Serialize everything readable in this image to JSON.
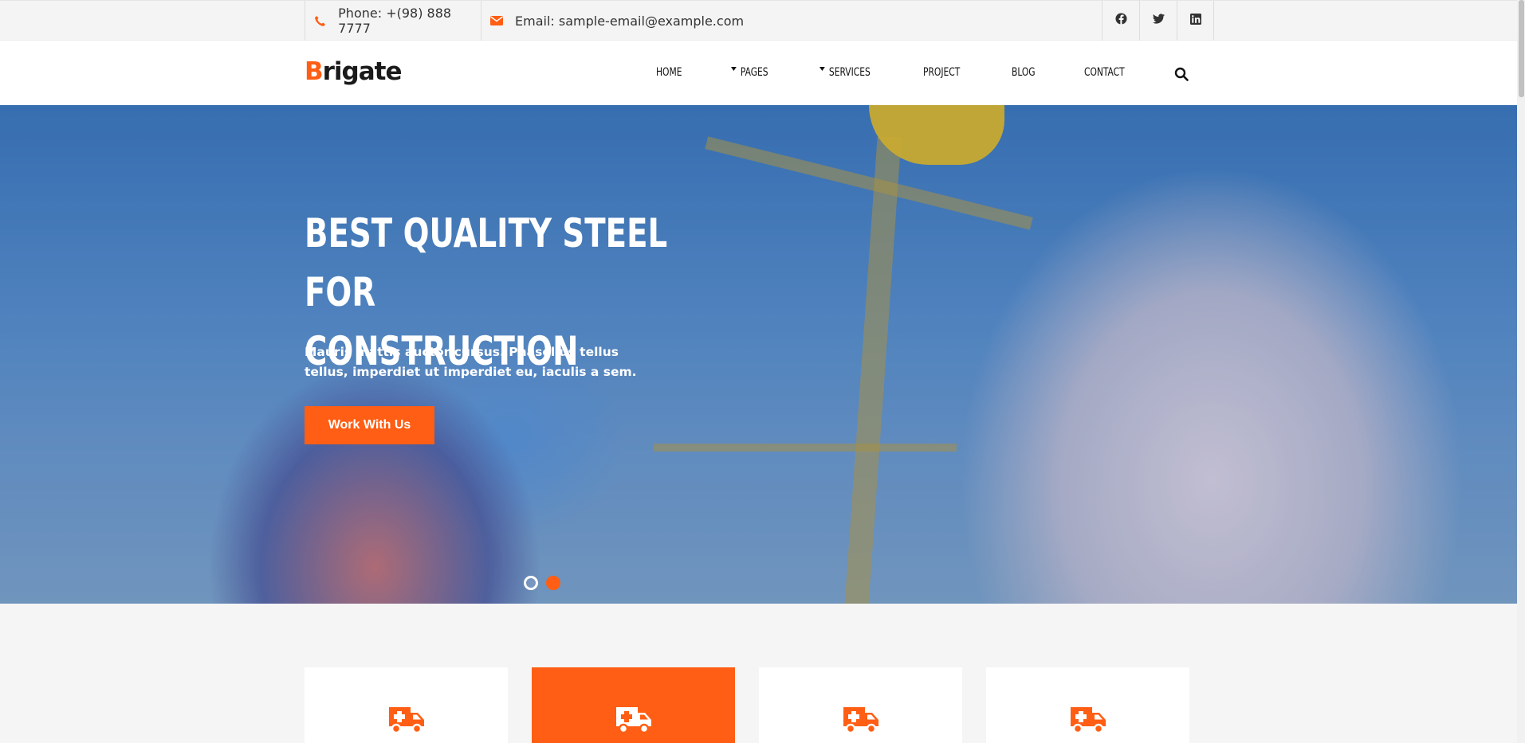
{
  "topbar": {
    "phone": "Phone: +(98) 888 7777",
    "email": "Email: sample-email@example.com",
    "social": [
      "facebook-icon",
      "twitter-icon",
      "linkedin-icon"
    ]
  },
  "header": {
    "logo_first": "B",
    "logo_rest": "rigate",
    "nav": [
      "HOME",
      "PAGES",
      "SERVICES",
      "PROJECT",
      "BLOG",
      "CONTACT"
    ]
  },
  "hero": {
    "title_line1": "BEST QUALITY STEEL FOR",
    "title_line2": "CONSTRUCTION",
    "text": "Mauris mattis auctor cursus. Phasellus tellus tellus, imperdiet ut imperdiet eu, iaculis a sem.",
    "cta": "Work With Us",
    "slides_total": 2,
    "slide_active": 2
  },
  "services": {
    "icons": [
      "ambulance-icon",
      "ambulance-icon",
      "ambulance-icon",
      "ambulance-icon"
    ],
    "active_index": 1
  },
  "colors": {
    "accent": "#ff5e14",
    "text": "#111111",
    "topbar_bg": "#f4f4f4"
  }
}
